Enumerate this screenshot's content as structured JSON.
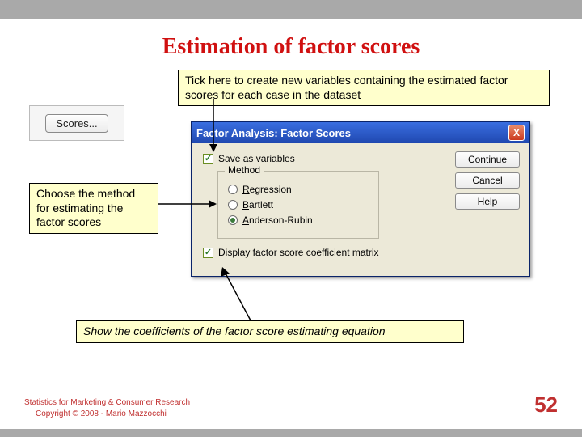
{
  "slide": {
    "title": "Estimation of factor scores",
    "page_number": "52"
  },
  "callouts": {
    "top": "Tick here to create new variables containing the estimated factor scores for each case in the dataset",
    "left": "Choose the method for estimating the factor scores",
    "bottom": "Show the coefficients of the factor score estimating equation"
  },
  "scores_button": {
    "label": "Scores..."
  },
  "dialog": {
    "title": "Factor Analysis: Factor Scores",
    "close": "X",
    "save_as_variables": {
      "label_pre": "S",
      "label_rest": "ave as variables",
      "checked": true
    },
    "method_group": {
      "title": "Method",
      "options": {
        "regression": {
          "u": "R",
          "rest": "egression",
          "selected": false
        },
        "bartlett": {
          "u": "B",
          "rest": "artlett",
          "selected": false
        },
        "anderson": {
          "u": "A",
          "rest": "nderson-Rubin",
          "selected": true
        }
      }
    },
    "display_matrix": {
      "label_pre": "D",
      "label_rest": "isplay factor score coefficient matrix",
      "checked": true
    },
    "buttons": {
      "continue": "Continue",
      "cancel": "Cancel",
      "help": "Help"
    }
  },
  "footer": {
    "line1": "Statistics for Marketing & Consumer Research",
    "line2": "Copyright © 2008 - Mario Mazzocchi"
  }
}
